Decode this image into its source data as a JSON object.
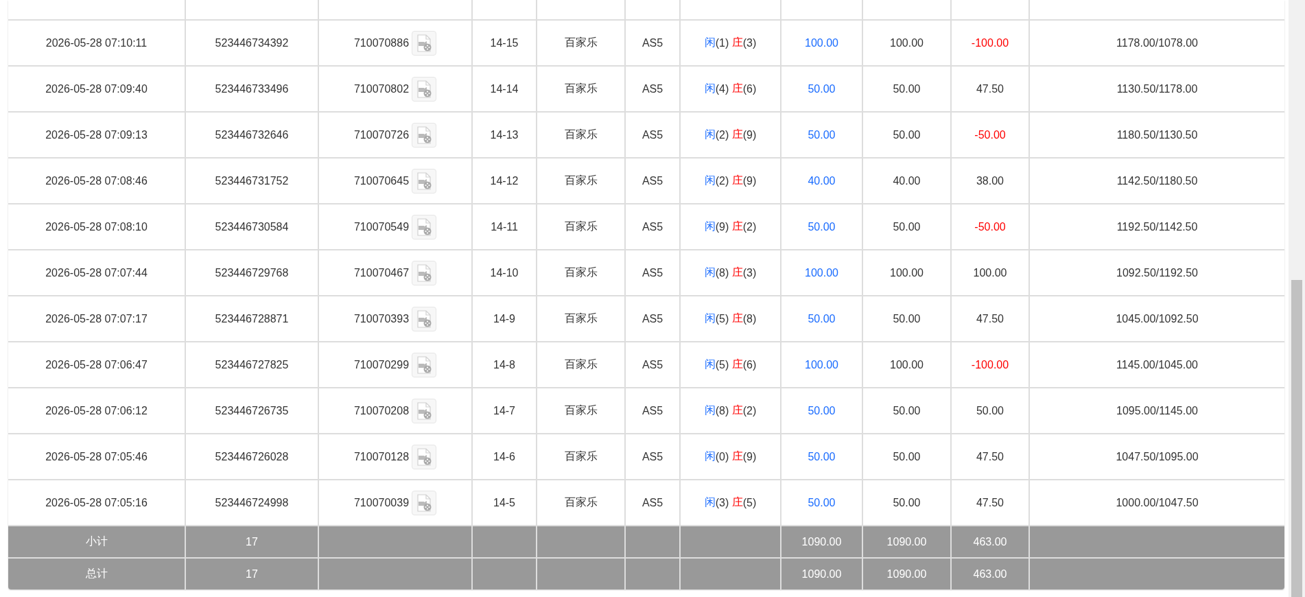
{
  "rows": [
    {
      "time": "2026-05-28 07:10:11",
      "bet_id": "523446734392",
      "round_id": "710070886",
      "shoe": "14-15",
      "game": "百家乐",
      "table": "AS5",
      "result": {
        "player_label": "闲",
        "player": "(1)",
        "banker_label": "庄",
        "banker": "(3)"
      },
      "bet": "100.00",
      "valid_bet": "100.00",
      "win_loss": "-100.00",
      "loss": true,
      "balance": "1178.00/1078.00"
    },
    {
      "time": "2026-05-28 07:09:40",
      "bet_id": "523446733496",
      "round_id": "710070802",
      "shoe": "14-14",
      "game": "百家乐",
      "table": "AS5",
      "result": {
        "player_label": "闲",
        "player": "(4)",
        "banker_label": "庄",
        "banker": "(6)"
      },
      "bet": "50.00",
      "valid_bet": "50.00",
      "win_loss": "47.50",
      "loss": false,
      "balance": "1130.50/1178.00"
    },
    {
      "time": "2026-05-28 07:09:13",
      "bet_id": "523446732646",
      "round_id": "710070726",
      "shoe": "14-13",
      "game": "百家乐",
      "table": "AS5",
      "result": {
        "player_label": "闲",
        "player": "(2)",
        "banker_label": "庄",
        "banker": "(9)"
      },
      "bet": "50.00",
      "valid_bet": "50.00",
      "win_loss": "-50.00",
      "loss": true,
      "balance": "1180.50/1130.50"
    },
    {
      "time": "2026-05-28 07:08:46",
      "bet_id": "523446731752",
      "round_id": "710070645",
      "shoe": "14-12",
      "game": "百家乐",
      "table": "AS5",
      "result": {
        "player_label": "闲",
        "player": "(2)",
        "banker_label": "庄",
        "banker": "(9)"
      },
      "bet": "40.00",
      "valid_bet": "40.00",
      "win_loss": "38.00",
      "loss": false,
      "balance": "1142.50/1180.50"
    },
    {
      "time": "2026-05-28 07:08:10",
      "bet_id": "523446730584",
      "round_id": "710070549",
      "shoe": "14-11",
      "game": "百家乐",
      "table": "AS5",
      "result": {
        "player_label": "闲",
        "player": "(9)",
        "banker_label": "庄",
        "banker": "(2)"
      },
      "bet": "50.00",
      "valid_bet": "50.00",
      "win_loss": "-50.00",
      "loss": true,
      "balance": "1192.50/1142.50"
    },
    {
      "time": "2026-05-28 07:07:44",
      "bet_id": "523446729768",
      "round_id": "710070467",
      "shoe": "14-10",
      "game": "百家乐",
      "table": "AS5",
      "result": {
        "player_label": "闲",
        "player": "(8)",
        "banker_label": "庄",
        "banker": "(3)"
      },
      "bet": "100.00",
      "valid_bet": "100.00",
      "win_loss": "100.00",
      "loss": false,
      "balance": "1092.50/1192.50"
    },
    {
      "time": "2026-05-28 07:07:17",
      "bet_id": "523446728871",
      "round_id": "710070393",
      "shoe": "14-9",
      "game": "百家乐",
      "table": "AS5",
      "result": {
        "player_label": "闲",
        "player": "(5)",
        "banker_label": "庄",
        "banker": "(8)"
      },
      "bet": "50.00",
      "valid_bet": "50.00",
      "win_loss": "47.50",
      "loss": false,
      "balance": "1045.00/1092.50"
    },
    {
      "time": "2026-05-28 07:06:47",
      "bet_id": "523446727825",
      "round_id": "710070299",
      "shoe": "14-8",
      "game": "百家乐",
      "table": "AS5",
      "result": {
        "player_label": "闲",
        "player": "(5)",
        "banker_label": "庄",
        "banker": "(6)"
      },
      "bet": "100.00",
      "valid_bet": "100.00",
      "win_loss": "-100.00",
      "loss": true,
      "balance": "1145.00/1045.00"
    },
    {
      "time": "2026-05-28 07:06:12",
      "bet_id": "523446726735",
      "round_id": "710070208",
      "shoe": "14-7",
      "game": "百家乐",
      "table": "AS5",
      "result": {
        "player_label": "闲",
        "player": "(8)",
        "banker_label": "庄",
        "banker": "(2)"
      },
      "bet": "50.00",
      "valid_bet": "50.00",
      "win_loss": "50.00",
      "loss": false,
      "balance": "1095.00/1145.00"
    },
    {
      "time": "2026-05-28 07:05:46",
      "bet_id": "523446726028",
      "round_id": "710070128",
      "shoe": "14-6",
      "game": "百家乐",
      "table": "AS5",
      "result": {
        "player_label": "闲",
        "player": "(0)",
        "banker_label": "庄",
        "banker": "(9)"
      },
      "bet": "50.00",
      "valid_bet": "50.00",
      "win_loss": "47.50",
      "loss": false,
      "balance": "1047.50/1095.00"
    },
    {
      "time": "2026-05-28 07:05:16",
      "bet_id": "523446724998",
      "round_id": "710070039",
      "shoe": "14-5",
      "game": "百家乐",
      "table": "AS5",
      "result": {
        "player_label": "闲",
        "player": "(3)",
        "banker_label": "庄",
        "banker": "(5)"
      },
      "bet": "50.00",
      "valid_bet": "50.00",
      "win_loss": "47.50",
      "loss": false,
      "balance": "1000.00/1047.50"
    }
  ],
  "totals": [
    {
      "label": "小计",
      "count": "17",
      "bet": "1090.00",
      "valid_bet": "1090.00",
      "win_loss": "463.00"
    },
    {
      "label": "总计",
      "count": "17",
      "bet": "1090.00",
      "valid_bet": "1090.00",
      "win_loss": "463.00"
    }
  ]
}
